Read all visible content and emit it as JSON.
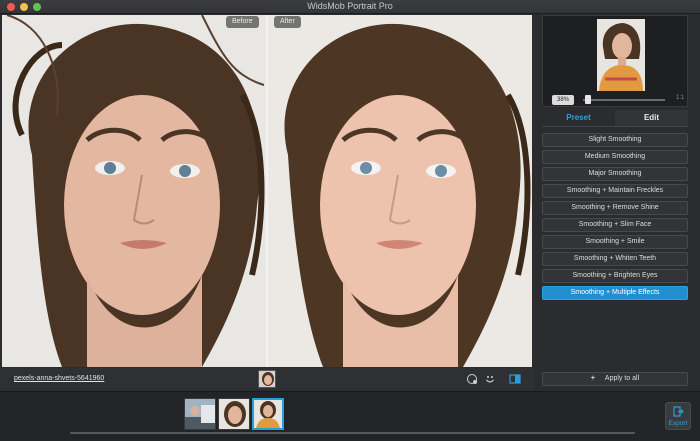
{
  "window": {
    "title": "WidsMob Portrait Pro"
  },
  "preview": {
    "before_label": "Before",
    "after_label": "After"
  },
  "infobar": {
    "filename": "pexels-anna-shvets-5641960"
  },
  "navigator": {
    "zoom": "38%",
    "zoom_value": 0.05,
    "fit_label": "1:1"
  },
  "tabs": {
    "preset": "Preset",
    "edit": "Edit",
    "active": "Preset"
  },
  "presets": [
    {
      "label": "Slight Smoothing",
      "active": false
    },
    {
      "label": "Medium Smoothing",
      "active": false
    },
    {
      "label": "Major Smoothing",
      "active": false
    },
    {
      "label": "Smoothing + Maintain Freckles",
      "active": false
    },
    {
      "label": "Smoothing + Remove Shine",
      "active": false
    },
    {
      "label": "Smoothing + Slim Face",
      "active": false
    },
    {
      "label": "Smoothing + Smile",
      "active": false
    },
    {
      "label": "Smoothing + Whiten Teeth",
      "active": false
    },
    {
      "label": "Smoothing + Brighten Eyes",
      "active": false
    },
    {
      "label": "Smoothing + Multiple Effects",
      "active": true
    }
  ],
  "apply": {
    "plus": "+",
    "label": "Apply to all"
  },
  "export": {
    "label": "Export"
  },
  "colors": {
    "accent": "#27a0d8",
    "active_preset": "#1f8fd0"
  }
}
